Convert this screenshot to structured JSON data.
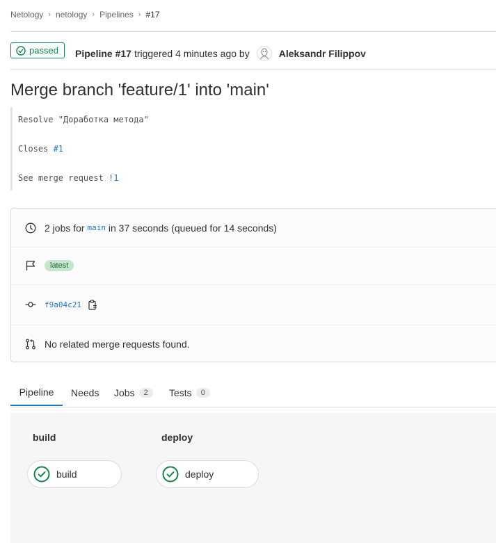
{
  "breadcrumb": {
    "items": [
      "Netology",
      "netology",
      "Pipelines"
    ],
    "current": "#17"
  },
  "header": {
    "status": "passed",
    "pipeline_label": "Pipeline #17",
    "triggered_text": "triggered 4 minutes ago by",
    "user": "Aleksandr Filippov"
  },
  "commit": {
    "title": "Merge branch 'feature/1' into 'main'",
    "line1": "Resolve \"Доработка метода\"",
    "line2_prefix": "Closes ",
    "line2_link": "#1",
    "line3_prefix": "See merge request ",
    "line3_link": "!1"
  },
  "info": {
    "jobs_prefix": "2 jobs for",
    "branch": "main",
    "jobs_suffix": "in 37 seconds (queued for 14 seconds)",
    "badge": "latest",
    "sha": "f9a04c21",
    "merge_requests": "No related merge requests found."
  },
  "tabs": [
    {
      "label": "Pipeline"
    },
    {
      "label": "Needs"
    },
    {
      "label": "Jobs",
      "count": "2"
    },
    {
      "label": "Tests",
      "count": "0"
    }
  ],
  "stages": [
    {
      "title": "build",
      "job": "build"
    },
    {
      "title": "deploy",
      "job": "deploy"
    }
  ],
  "colors": {
    "success": "#108548",
    "link": "#1f75cb"
  }
}
